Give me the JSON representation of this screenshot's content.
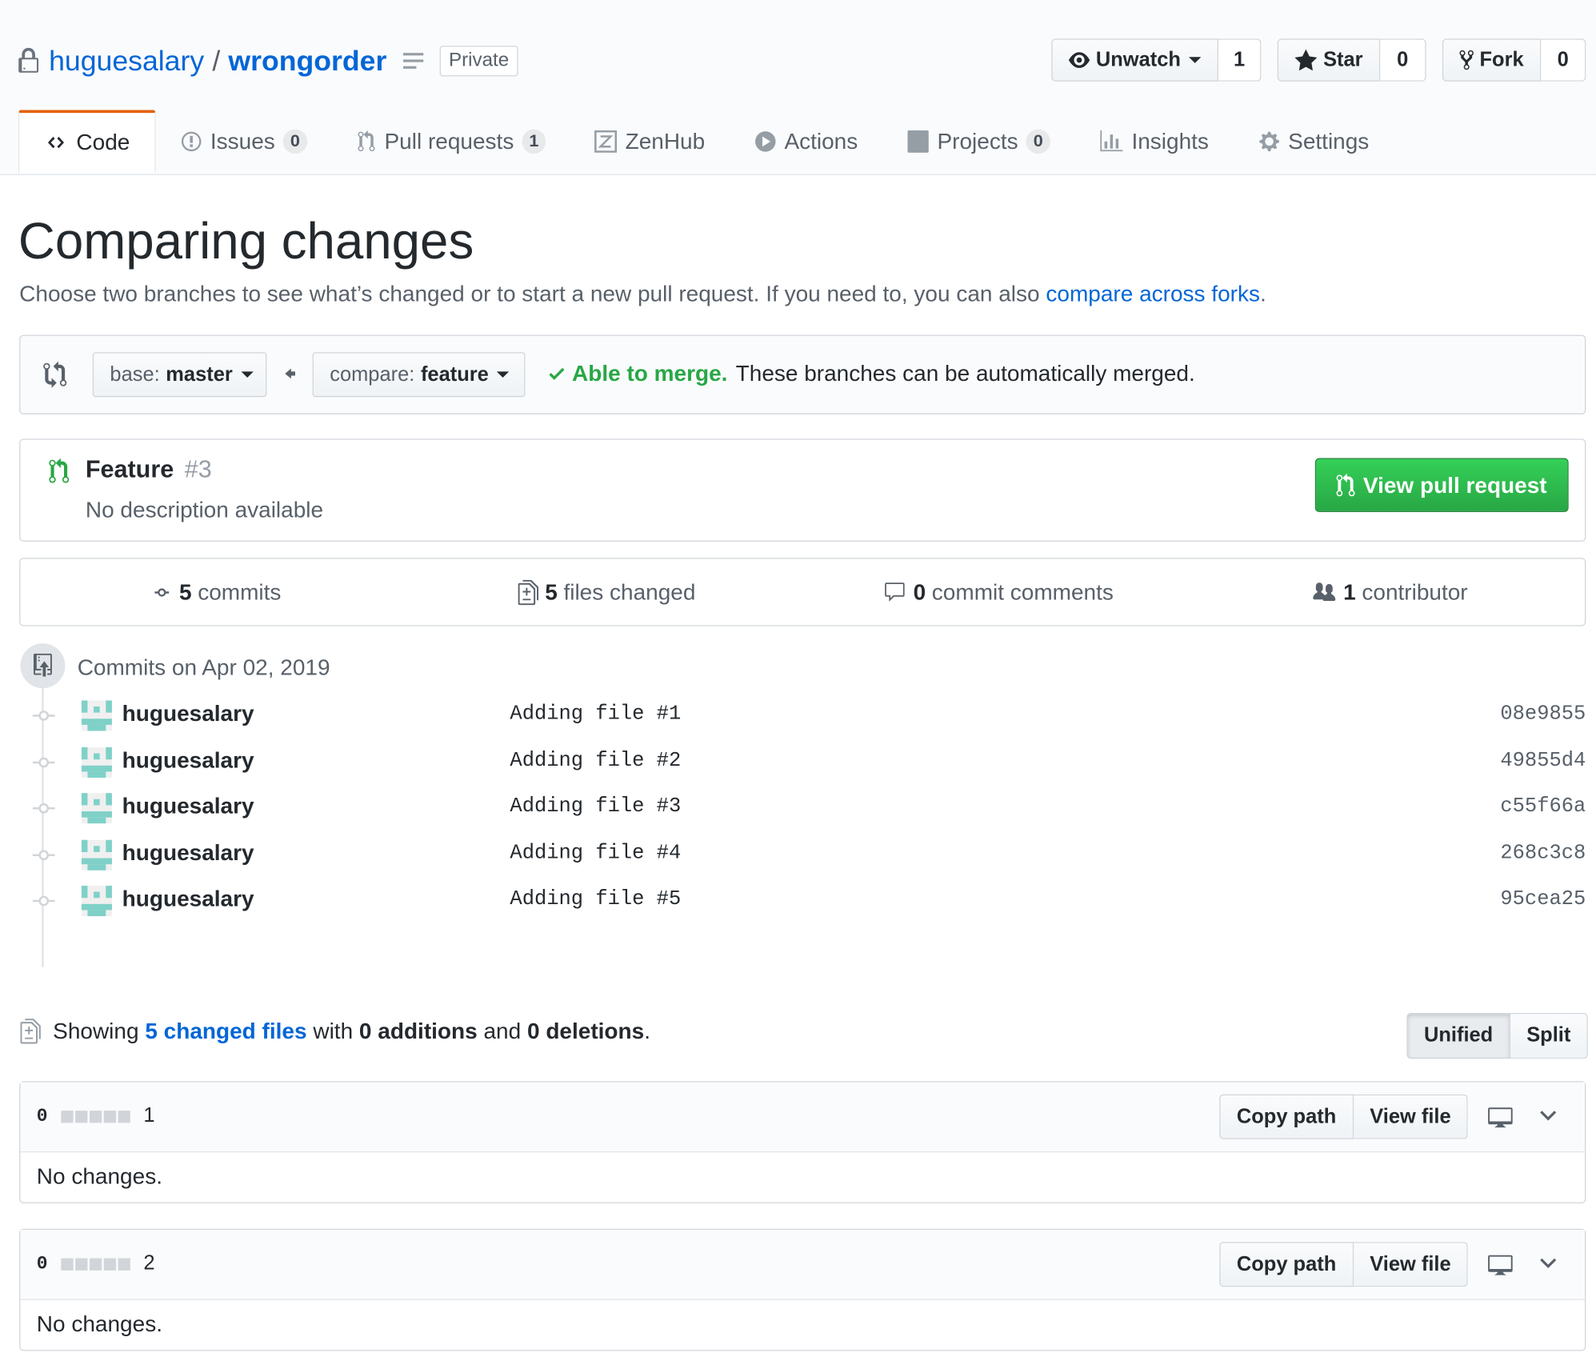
{
  "repo": {
    "owner": "huguesalary",
    "separator": "/",
    "name": "wrongorder",
    "visibility": "Private"
  },
  "actions": {
    "unwatch_label": "Unwatch",
    "unwatch_count": "1",
    "star_label": "Star",
    "star_count": "0",
    "fork_label": "Fork",
    "fork_count": "0"
  },
  "tabs": [
    {
      "label": "Code",
      "icon": "code-icon",
      "count": ""
    },
    {
      "label": "Issues",
      "icon": "issue-icon",
      "count": "0"
    },
    {
      "label": "Pull requests",
      "icon": "pull-request-icon",
      "count": "1"
    },
    {
      "label": "ZenHub",
      "icon": "zenhub-icon",
      "count": ""
    },
    {
      "label": "Actions",
      "icon": "play-icon",
      "count": ""
    },
    {
      "label": "Projects",
      "icon": "project-icon",
      "count": "0"
    },
    {
      "label": "Insights",
      "icon": "graph-icon",
      "count": ""
    },
    {
      "label": "Settings",
      "icon": "gear-icon",
      "count": ""
    }
  ],
  "page": {
    "title": "Comparing changes",
    "subtitle_text": "Choose two branches to see what’s changed or to start a new pull request. If you need to, you can also",
    "subtitle_link": "compare across forks",
    "subtitle_end": "."
  },
  "range": {
    "base_prefix": "base:",
    "base_branch": "master",
    "compare_prefix": "compare:",
    "compare_branch": "feature",
    "merge_status": "Able to merge.",
    "merge_message": "These branches can be automatically merged."
  },
  "pull_request": {
    "title": "Feature",
    "number": "#3",
    "description": "No description available",
    "button_label": "View pull request"
  },
  "stats": {
    "commits_count": "5",
    "commits_label": "commits",
    "files_count": "5",
    "files_label": "files changed",
    "comments_count": "0",
    "comments_label": "commit comments",
    "contributors_count": "1",
    "contributors_label": "contributor"
  },
  "commit_group": {
    "heading": "Commits on Apr 02, 2019",
    "commits": [
      {
        "author": "huguesalary",
        "message": "Adding file #1",
        "sha": "08e9855"
      },
      {
        "author": "huguesalary",
        "message": "Adding file #2",
        "sha": "49855d4"
      },
      {
        "author": "huguesalary",
        "message": "Adding file #3",
        "sha": "c55f66a"
      },
      {
        "author": "huguesalary",
        "message": "Adding file #4",
        "sha": "268c3c8"
      },
      {
        "author": "huguesalary",
        "message": "Adding file #5",
        "sha": "95cea25"
      }
    ]
  },
  "summary": {
    "showing": "Showing",
    "changed_files_link": "5 changed files",
    "with": "with",
    "additions": "0 additions",
    "and": "and",
    "deletions": "0 deletions",
    "end": "."
  },
  "view_toggle": {
    "unified": "Unified",
    "split": "Split"
  },
  "files": [
    {
      "diffstat": "0",
      "name": "1",
      "copy_path": "Copy path",
      "view_file": "View file",
      "body": "No changes."
    },
    {
      "diffstat": "0",
      "name": "2",
      "copy_path": "Copy path",
      "view_file": "View file",
      "body": "No changes."
    }
  ],
  "colors": {
    "link": "#0366d6",
    "green": "#28a745",
    "tab_accent": "#e36209",
    "avatar": "#7fd1c8"
  }
}
